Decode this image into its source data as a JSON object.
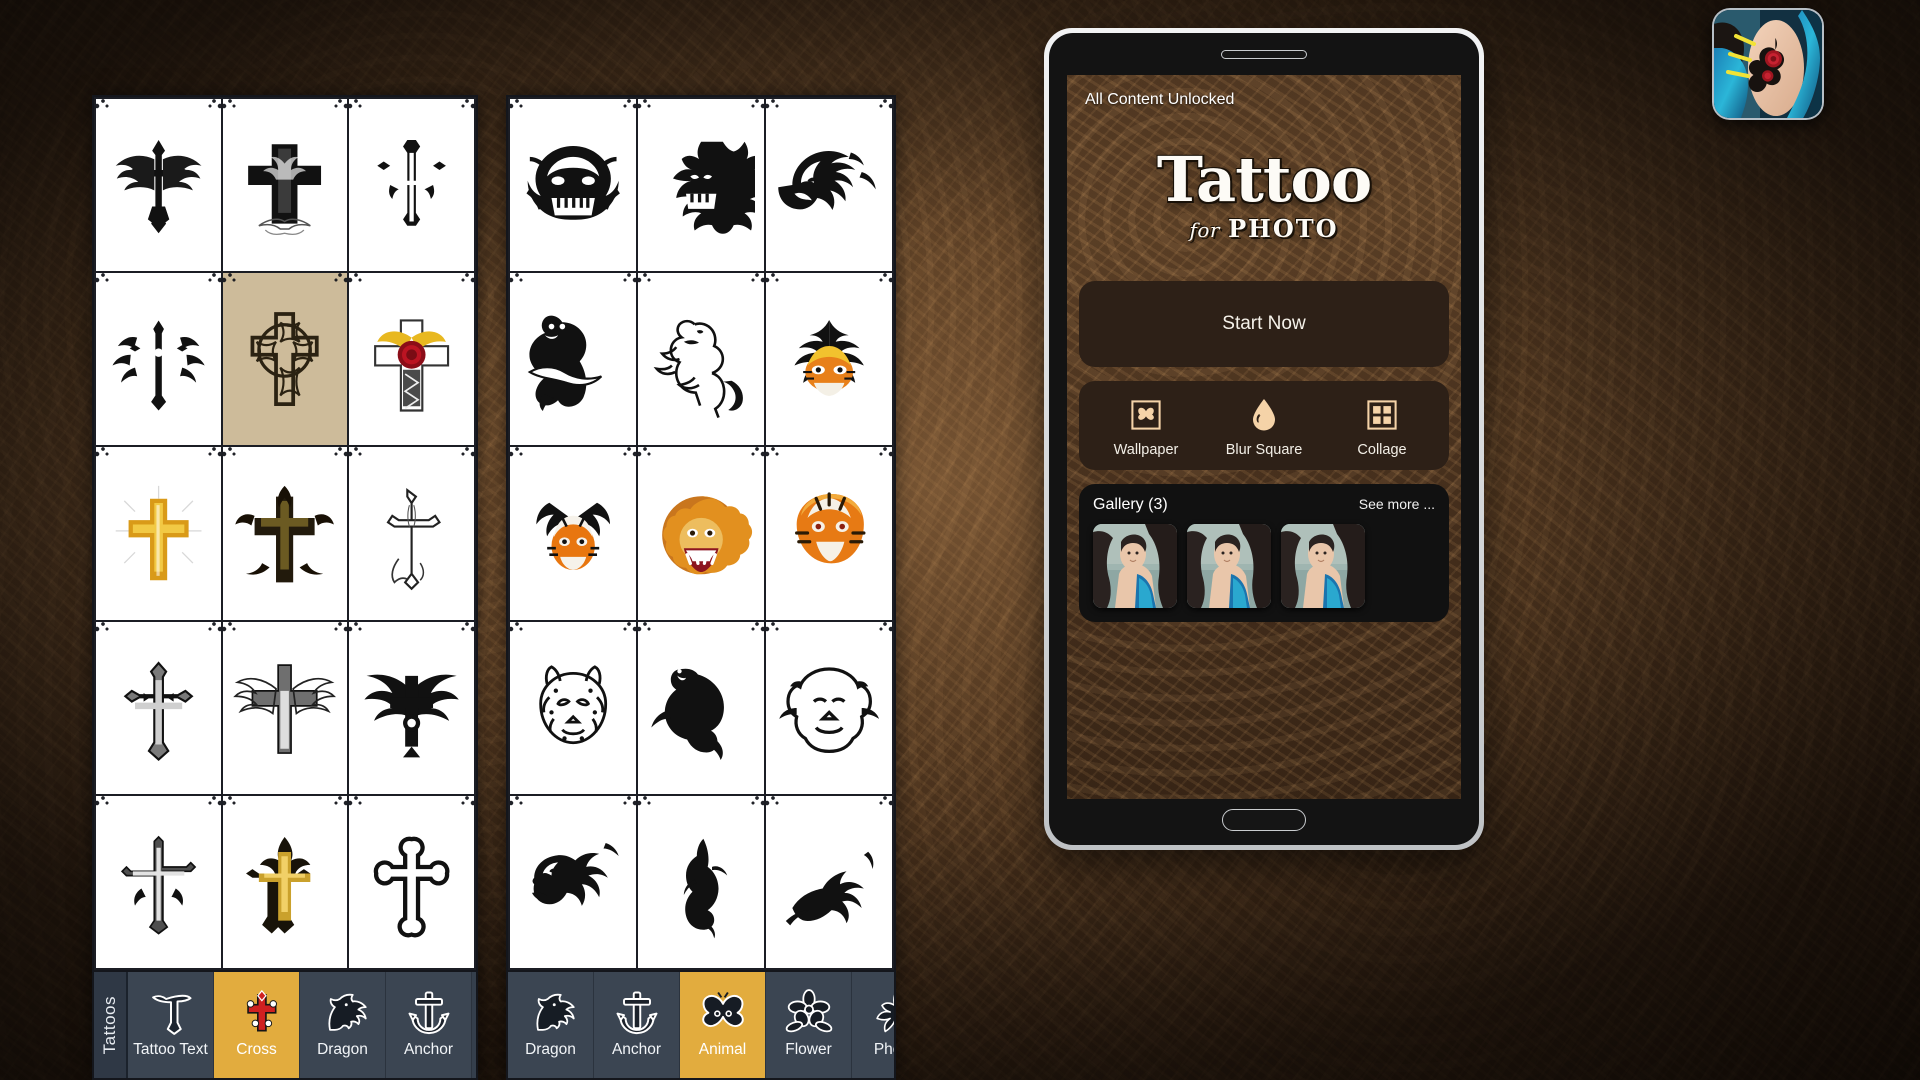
{
  "background": {
    "theme_color": "#6d4d2e"
  },
  "app_icon": {
    "name": "app-icon-tattoo-photo",
    "alt": "Woman with tribal rose tattoo on arm"
  },
  "panels": [
    {
      "id": "left",
      "category": "Cross",
      "selected_cell_index": 4,
      "cells": [
        {
          "name": "winged-cross",
          "type": "cross-wings"
        },
        {
          "name": "gothic-cross-scroll",
          "type": "cross-gothic"
        },
        {
          "name": "ornate-cross",
          "type": "cross-ornate"
        },
        {
          "name": "tribal-flame-cross",
          "type": "cross-flame"
        },
        {
          "name": "celtic-knot-cross",
          "type": "cross-celtic"
        },
        {
          "name": "heart-rose-cross",
          "type": "cross-color"
        },
        {
          "name": "golden-cross-rays",
          "type": "cross-gold"
        },
        {
          "name": "thorn-cross",
          "type": "cross-thorn"
        },
        {
          "name": "sketch-cross",
          "type": "cross-sketch"
        },
        {
          "name": "engraved-cross",
          "type": "cross-engraved"
        },
        {
          "name": "angel-wing-cross",
          "type": "cross-wings2"
        },
        {
          "name": "eagle-cross",
          "type": "cross-eagle"
        },
        {
          "name": "filigree-cross",
          "type": "cross-filigree"
        },
        {
          "name": "gold-tribal-cross",
          "type": "cross-goldtribal"
        },
        {
          "name": "outline-cross",
          "type": "cross-outline"
        }
      ],
      "tabs_label": "Tattoos",
      "tabs": [
        {
          "label": "Tattoo Text",
          "icon": "letter-t-icon",
          "active": false
        },
        {
          "label": "Cross",
          "icon": "cross-icon",
          "active": true
        },
        {
          "label": "Dragon",
          "icon": "dragon-icon",
          "active": false
        },
        {
          "label": "Anchor",
          "icon": "anchor-icon",
          "active": false
        }
      ]
    },
    {
      "id": "right",
      "category": "Animal",
      "selected_cell_index": -1,
      "cells": [
        {
          "name": "tribal-tiger-face",
          "type": "tiger-tribal"
        },
        {
          "name": "tribal-lion-face",
          "type": "lion-tribal"
        },
        {
          "name": "tribal-tiger-profile",
          "type": "tiger-profile"
        },
        {
          "name": "black-panther-banner",
          "type": "panther"
        },
        {
          "name": "heraldic-lion",
          "type": "lion-heraldic"
        },
        {
          "name": "flame-tiger-eyes",
          "type": "tiger-flame"
        },
        {
          "name": "color-tiger-tribal",
          "type": "tiger-color"
        },
        {
          "name": "roaring-lion-color",
          "type": "lion-color"
        },
        {
          "name": "orange-tiger-head",
          "type": "tiger-head"
        },
        {
          "name": "leopard-face",
          "type": "leopard"
        },
        {
          "name": "leaping-panther",
          "type": "panther-leap"
        },
        {
          "name": "lion-head-outline",
          "type": "lion-outline"
        },
        {
          "name": "tribal-tiger-leap",
          "type": "tiger-leap"
        },
        {
          "name": "tribal-panther-slim",
          "type": "panther-slim"
        },
        {
          "name": "tribal-leaping-cat",
          "type": "cat-leap"
        }
      ],
      "tabs_label": "",
      "tabs": [
        {
          "label": "Dragon",
          "icon": "dragon-icon",
          "active": false
        },
        {
          "label": "Anchor",
          "icon": "anchor-icon",
          "active": false
        },
        {
          "label": "Animal",
          "icon": "butterfly-icon",
          "active": true
        },
        {
          "label": "Flower",
          "icon": "flower-icon",
          "active": false
        },
        {
          "label": "Phoer",
          "icon": "phoenix-icon",
          "active": false
        }
      ]
    }
  ],
  "tablet": {
    "status_text": "All Content Unlocked",
    "logo": {
      "main": "Tattoo",
      "for": "for",
      "photo": "PHOTO"
    },
    "start_button": {
      "label": "Start Now"
    },
    "actions": [
      {
        "label": "Wallpaper",
        "icon": "butterfly-framed-icon"
      },
      {
        "label": "Blur Square",
        "icon": "water-drop-icon"
      },
      {
        "label": "Collage",
        "icon": "grid-four-icon"
      }
    ],
    "gallery": {
      "title": "Gallery (3)",
      "see_more": "See more ...",
      "thumbs": [
        {
          "name": "gallery-thumb-1",
          "alt": "Woman with colorful tattoo on shoulder"
        },
        {
          "name": "gallery-thumb-2",
          "alt": "Woman with butterfly tattoo on shoulder"
        },
        {
          "name": "gallery-thumb-3",
          "alt": "Woman with black tribal tattoo on shoulder"
        }
      ]
    },
    "colors": {
      "accent": "#f5d3a8",
      "card": "#2d2017",
      "gallery_card": "#111111",
      "tab_active": "#e2ac3e"
    }
  }
}
